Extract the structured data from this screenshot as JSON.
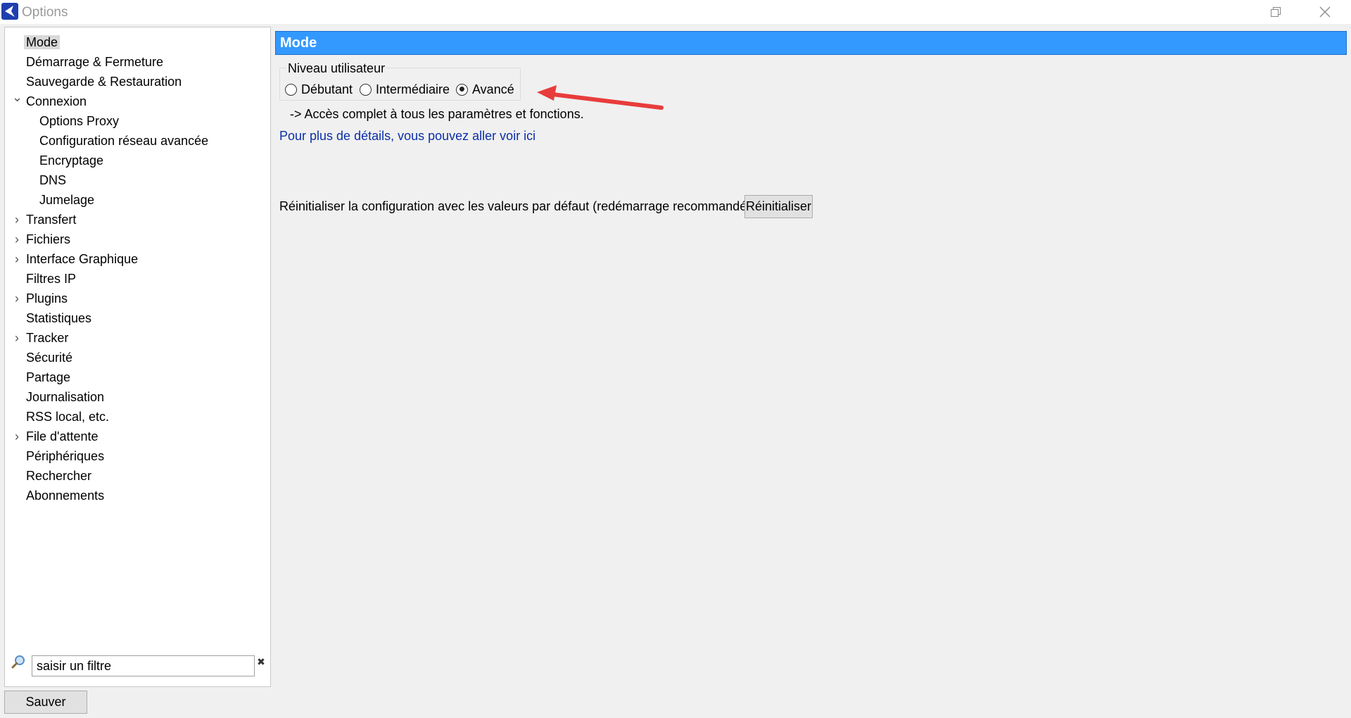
{
  "window": {
    "title": "Options"
  },
  "sidebar": {
    "items": [
      {
        "label": "Mode",
        "selected": true,
        "expander": ""
      },
      {
        "label": "Démarrage & Fermeture",
        "expander": ""
      },
      {
        "label": "Sauvegarde & Restauration",
        "expander": ""
      },
      {
        "label": "Connexion",
        "expander": "expanded"
      },
      {
        "label": "Options Proxy",
        "child": true
      },
      {
        "label": "Configuration réseau avancée",
        "child": true
      },
      {
        "label": "Encryptage",
        "child": true
      },
      {
        "label": "DNS",
        "child": true
      },
      {
        "label": "Jumelage",
        "child": true
      },
      {
        "label": "Transfert",
        "expander": "collapsed"
      },
      {
        "label": "Fichiers",
        "expander": "collapsed"
      },
      {
        "label": "Interface Graphique",
        "expander": "collapsed"
      },
      {
        "label": "Filtres IP",
        "expander": ""
      },
      {
        "label": "Plugins",
        "expander": "collapsed"
      },
      {
        "label": "Statistiques",
        "expander": ""
      },
      {
        "label": "Tracker",
        "expander": "collapsed"
      },
      {
        "label": "Sécurité",
        "expander": ""
      },
      {
        "label": "Partage",
        "expander": ""
      },
      {
        "label": "Journalisation",
        "expander": ""
      },
      {
        "label": "RSS local, etc.",
        "expander": ""
      },
      {
        "label": "File d'attente",
        "expander": "collapsed"
      },
      {
        "label": "Périphériques",
        "expander": ""
      },
      {
        "label": "Rechercher",
        "expander": ""
      },
      {
        "label": "Abonnements",
        "expander": ""
      }
    ],
    "filter": {
      "value": "saisir un filtre"
    }
  },
  "footer": {
    "save_label": "Sauver"
  },
  "main": {
    "header": "Mode",
    "user_level": {
      "title": "Niveau utilisateur",
      "options": [
        "Débutant",
        "Intermédiaire",
        "Avancé"
      ],
      "selected": "Avancé"
    },
    "access_text": "-> Accès complet à tous les paramètres et fonctions.",
    "details_link": "Pour plus de détails, vous pouvez aller voir ici",
    "reset_text": "Réinitialiser la configuration avec les valeurs par défaut (redémarrage recommandé)",
    "reset_label": "Réinitialiser"
  },
  "annotation": {
    "arrow_color": "#e83c3c"
  },
  "colors": {
    "header_bg": "#3399ff",
    "link": "#0b2fa8",
    "selection": "#d9d9d9"
  }
}
